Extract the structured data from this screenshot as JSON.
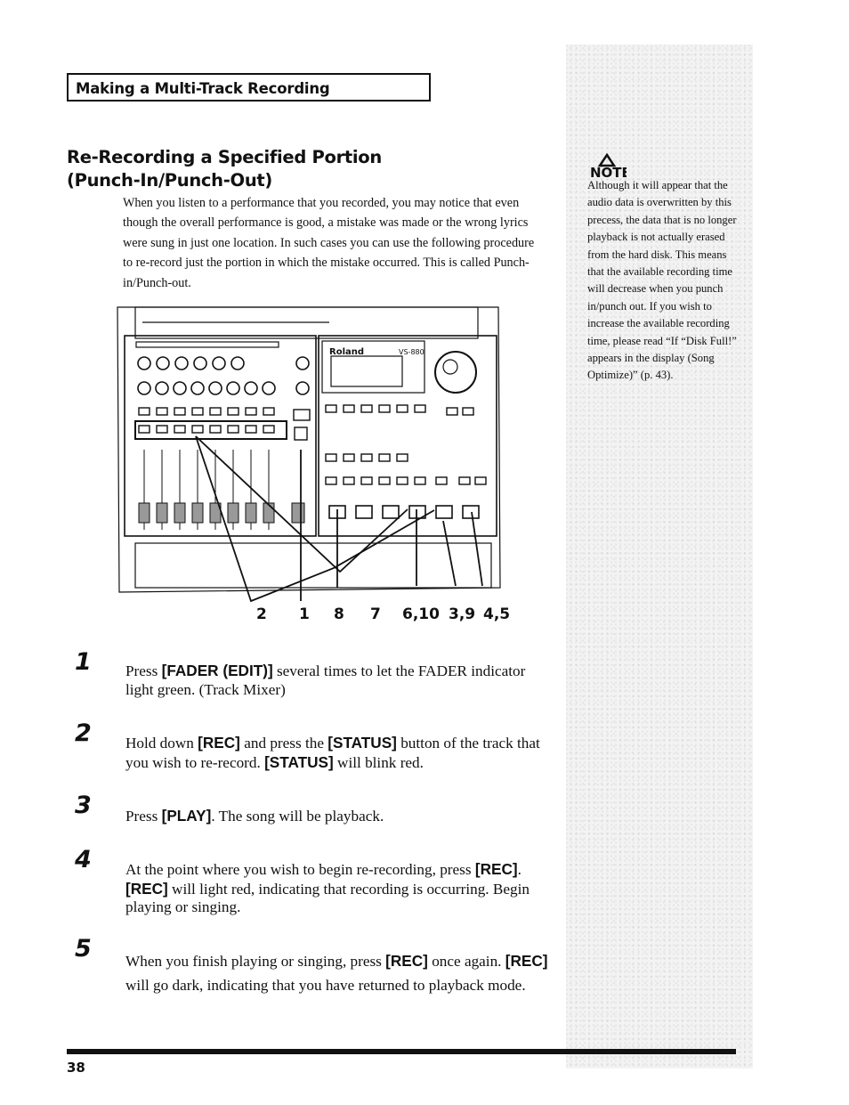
{
  "header": {
    "section": "Making a Multi-Track Recording"
  },
  "title": {
    "line1": "Re-Recording a Specified Portion",
    "line2": "(Punch-In/Punch-Out)"
  },
  "intro": "When you listen to a performance that you recorded, you may notice that even though the overall performance is good, a mistake was made or the wrong lyrics were sung in just one location. In such cases you can use the following procedure to re-record just the portion in which the mistake occurred. This is called Punch-in/Punch-out.",
  "note": {
    "icon_label": "NOTE",
    "text": "Although it will appear that the audio data is overwritten by this precess, the data that is no longer playback is not actually erased from the hard disk. This means that the available recording time will decrease when you punch in/punch out. If you wish to increase the available recording time, please read “If “Disk Full!” appears in the display (Song Optimize)” (p. 43)."
  },
  "diagram": {
    "brand": "Roland",
    "model": "VS-880",
    "callouts": [
      "2",
      "1",
      "8",
      "7",
      "6,10",
      "3,9",
      "4,5"
    ]
  },
  "steps": [
    {
      "num": "1",
      "parts": [
        [
          "t",
          "Press "
        ],
        [
          "b",
          "[FADER (EDIT)]"
        ],
        [
          "t",
          " several times to let the FADER indicator light green. (Track Mixer)"
        ]
      ]
    },
    {
      "num": "2",
      "parts": [
        [
          "t",
          "Hold down "
        ],
        [
          "b",
          "[REC]"
        ],
        [
          "t",
          " and press the "
        ],
        [
          "b",
          "[STATUS]"
        ],
        [
          "t",
          " button of the track that you wish to re-record. "
        ],
        [
          "b",
          "[STATUS]"
        ],
        [
          "t",
          " will blink red."
        ]
      ]
    },
    {
      "num": "3",
      "parts": [
        [
          "t",
          "Press "
        ],
        [
          "b",
          "[PLAY]"
        ],
        [
          "t",
          ". The song will be playback."
        ]
      ]
    },
    {
      "num": "4",
      "parts": [
        [
          "t",
          "At the point where you wish to begin re-recording, press "
        ],
        [
          "b",
          "[REC]"
        ],
        [
          "t",
          ". "
        ],
        [
          "b",
          "[REC]"
        ],
        [
          "t",
          " will light red, indicating that recording is occurring. Begin playing or singing."
        ]
      ]
    },
    {
      "num": "5",
      "parts": [
        [
          "t",
          "When you finish playing or singing, press "
        ],
        [
          "b",
          "[REC]"
        ],
        [
          "t",
          " once again. "
        ],
        [
          "b",
          "[REC]"
        ],
        [
          "t",
          " will go dark, indicating that you have returned to playback mode."
        ]
      ]
    }
  ],
  "footer": {
    "page_number": "38"
  }
}
